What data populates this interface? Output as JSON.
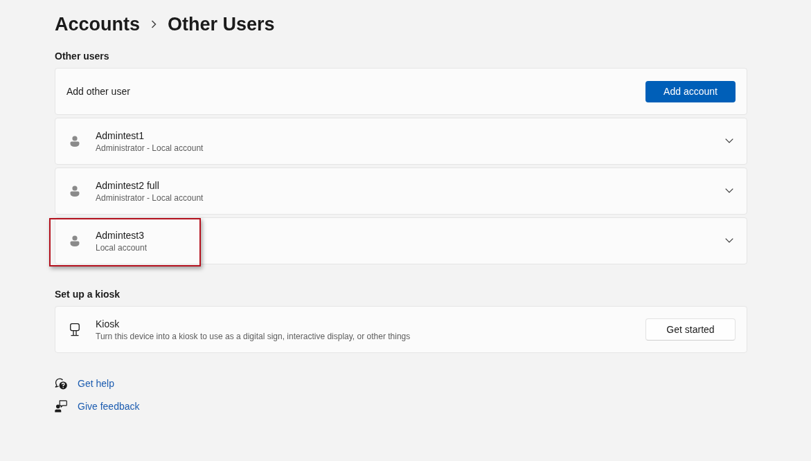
{
  "breadcrumb": {
    "items": [
      "Accounts",
      "Other Users"
    ]
  },
  "other_users": {
    "heading": "Other users",
    "add_user": {
      "label": "Add other user",
      "button": "Add account"
    },
    "users": [
      {
        "name": "Admintest1",
        "detail": "Administrator - Local account",
        "expanded": false,
        "highlighted": false
      },
      {
        "name": "Admintest2 full",
        "detail": "Administrator - Local account",
        "expanded": false,
        "highlighted": false
      },
      {
        "name": "Admintest3",
        "detail": "Local account",
        "expanded": false,
        "highlighted": true
      }
    ]
  },
  "kiosk": {
    "heading": "Set up a kiosk",
    "title": "Kiosk",
    "description": "Turn this device into a kiosk to use as a digital sign, interactive display, or other things",
    "button": "Get started"
  },
  "links": [
    {
      "kind": "help",
      "label": "Get help"
    },
    {
      "kind": "feedback",
      "label": "Give feedback"
    }
  ]
}
